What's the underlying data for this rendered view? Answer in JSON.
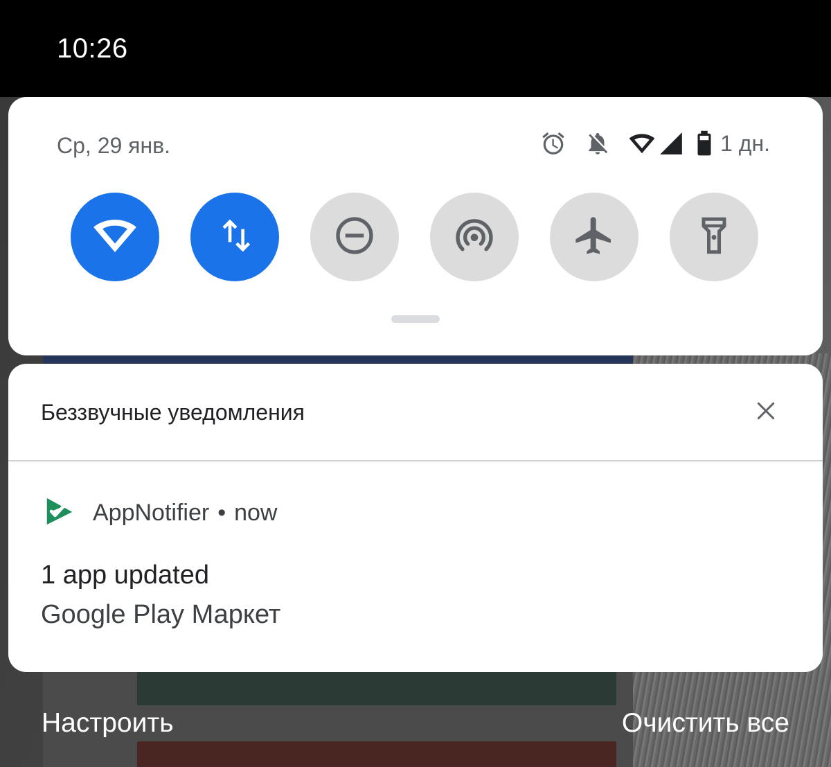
{
  "status_bar": {
    "time": "10:26"
  },
  "quick_settings": {
    "date": "Ср, 29 янв.",
    "status_icons": [
      "alarm-icon",
      "notifications-off-icon",
      "wifi-icon",
      "cell-signal-icon",
      "battery-icon"
    ],
    "battery_text": "1 дн.",
    "tiles": [
      {
        "icon": "wifi-icon",
        "state": "on"
      },
      {
        "icon": "mobile-data-icon",
        "state": "on"
      },
      {
        "icon": "do-not-disturb-icon",
        "state": "off"
      },
      {
        "icon": "hotspot-icon",
        "state": "off"
      },
      {
        "icon": "airplane-icon",
        "state": "off"
      },
      {
        "icon": "flashlight-icon",
        "state": "off"
      }
    ]
  },
  "notifications": {
    "header": "Беззвучные уведомления",
    "item": {
      "app_name": "AppNotifier",
      "separator": "•",
      "time": "now",
      "title": "1 app updated",
      "body": "Google Play Маркет"
    }
  },
  "footer": {
    "manage": "Настроить",
    "clear_all": "Очистить все"
  },
  "colors": {
    "accent": "#1a73e8",
    "tile_off": "#dcdcdc",
    "app_icon": "#1e8e5a"
  }
}
